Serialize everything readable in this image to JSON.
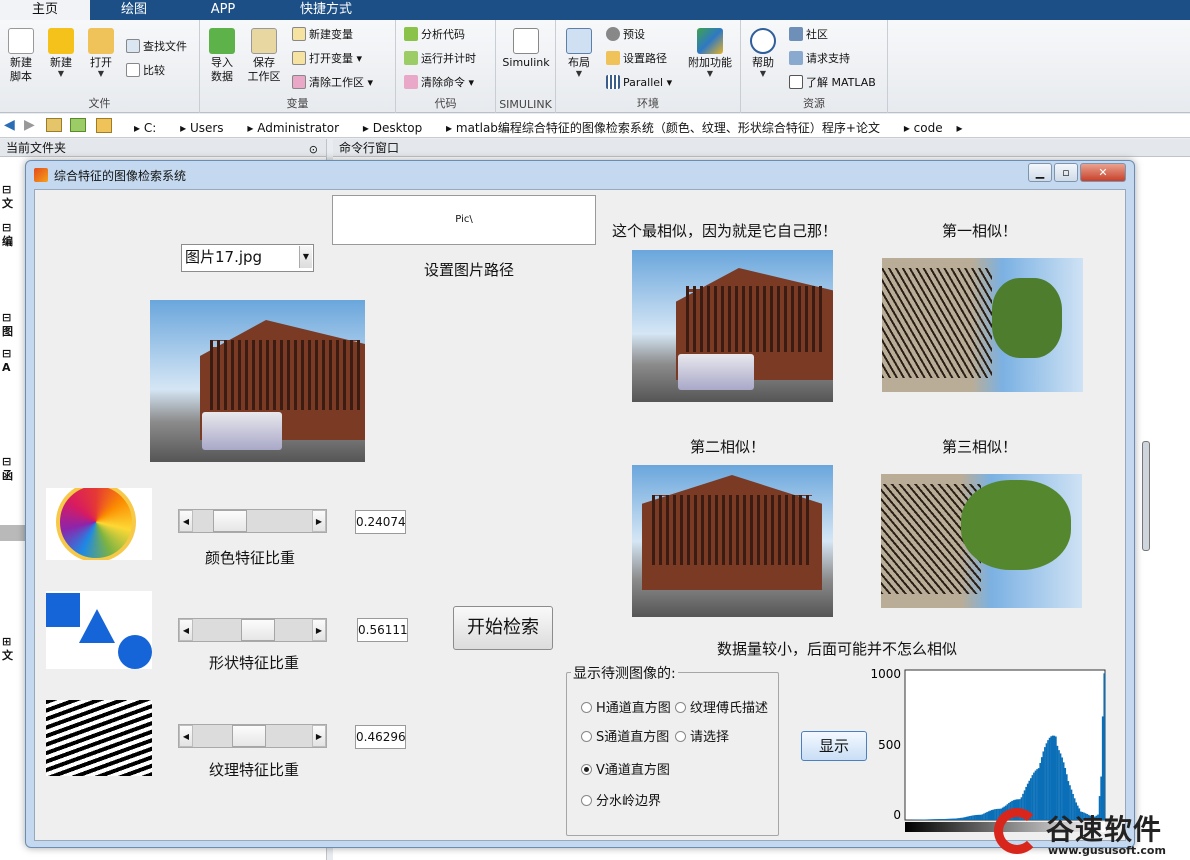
{
  "ribbon_tabs": [
    "主页",
    "绘图",
    "APP",
    "快捷方式"
  ],
  "ribbon": {
    "file": {
      "label": "文件",
      "new_script": "新建\n脚本",
      "new": "新建",
      "open": "打开",
      "find_files": "查找文件",
      "compare": "比较"
    },
    "variable": {
      "label": "变量",
      "import": "导入\n数据",
      "save_ws": "保存\n工作区",
      "new_var": "新建变量",
      "open_var": "打开变量",
      "clear_ws": "清除工作区"
    },
    "code": {
      "label": "代码",
      "analyze": "分析代码",
      "run_time": "运行并计时",
      "clear_cmd": "清除命令"
    },
    "simulink": {
      "label": "SIMULINK",
      "simulink": "Simulink"
    },
    "env": {
      "label": "环境",
      "layout": "布局",
      "prefs": "预设",
      "set_path": "设置路径",
      "parallel": "Parallel",
      "addons": "附加功能"
    },
    "resources": {
      "label": "资源",
      "help": "帮助",
      "community": "社区",
      "support": "请求支持",
      "learn": "了解 MATLAB"
    }
  },
  "address": {
    "crumbs": [
      "C:",
      "Users",
      "Administrator",
      "Desktop",
      "matlab编程综合特征的图像检索系统（颜色、纹理、形状综合特征）程序+论文",
      "code"
    ]
  },
  "panes": {
    "current_folder": "当前文件夹",
    "command_window": "命令行窗口",
    "left_tree": [
      "文",
      "编",
      "图",
      "A",
      "函",
      "文"
    ]
  },
  "figure": {
    "title": "综合特征的图像检索系统",
    "path_value": "Pic\\",
    "path_label": "设置图片路径",
    "image_select": "图片17.jpg",
    "color_label": "颜色特征比重",
    "shape_label": "形状特征比重",
    "texture_label": "纹理特征比重",
    "color_value": "0.24074",
    "shape_value": "0.56111",
    "texture_value": "0.46296",
    "color_weight": 0.24074,
    "shape_weight": 0.56111,
    "texture_weight": 0.46296,
    "search_button": "开始检索",
    "result_self": "这个最相似，因为就是它自己那！",
    "result_1": "第一相似！",
    "result_2": "第二相似！",
    "result_3": "第三相似！",
    "note": "数据量较小，后面可能并不怎么相似",
    "radio_group_title": "显示待测图像的:",
    "radios": [
      "H通道直方图",
      "纹理傅氏描述",
      "S通道直方图",
      "请选择",
      "V通道直方图",
      "分水岭边界"
    ],
    "selected_radio": "V通道直方图",
    "show_button": "显示"
  },
  "chart_data": {
    "type": "bar",
    "title": "",
    "xlabel": "",
    "ylabel": "",
    "ylim": [
      0,
      1000
    ],
    "yticks": [
      "1000",
      "500",
      "0"
    ],
    "description_series": {
      "name": "",
      "x": [
        0,
        64,
        96,
        128,
        148,
        160,
        176,
        192,
        208,
        224,
        240,
        246,
        250,
        252,
        254,
        255
      ],
      "values": [
        0,
        10,
        40,
        100,
        170,
        280,
        480,
        620,
        260,
        60,
        20,
        40,
        300,
        700,
        980,
        1000
      ]
    }
  },
  "watermark": {
    "text": "谷速软件",
    "url": "www.gususoft.com"
  },
  "colors": {
    "tab_bar": "#1b4f86",
    "hist_bar": "#0b6fb8",
    "accent": "#1b4f86"
  }
}
